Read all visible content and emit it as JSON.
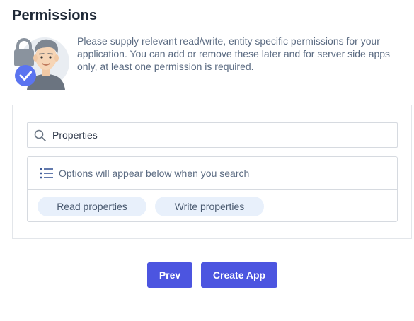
{
  "header": {
    "title": "Permissions"
  },
  "intro": {
    "description": "Please supply relevant read/write, entity specific permissions for your application. You can add or remove these later and for server side apps only, at least one permission is required."
  },
  "search": {
    "value": "Properties",
    "icon": "search-icon"
  },
  "options": {
    "hint": "Options will appear below when you search",
    "hint_icon": "list-icon",
    "chips": [
      {
        "label": "Read properties"
      },
      {
        "label": "Write properties"
      }
    ]
  },
  "footer": {
    "prev_label": "Prev",
    "create_label": "Create App"
  },
  "colors": {
    "accent": "#4c55e0",
    "chip_bg": "#e8f0fb",
    "text_muted": "#5b6b82",
    "title": "#1f2937"
  }
}
